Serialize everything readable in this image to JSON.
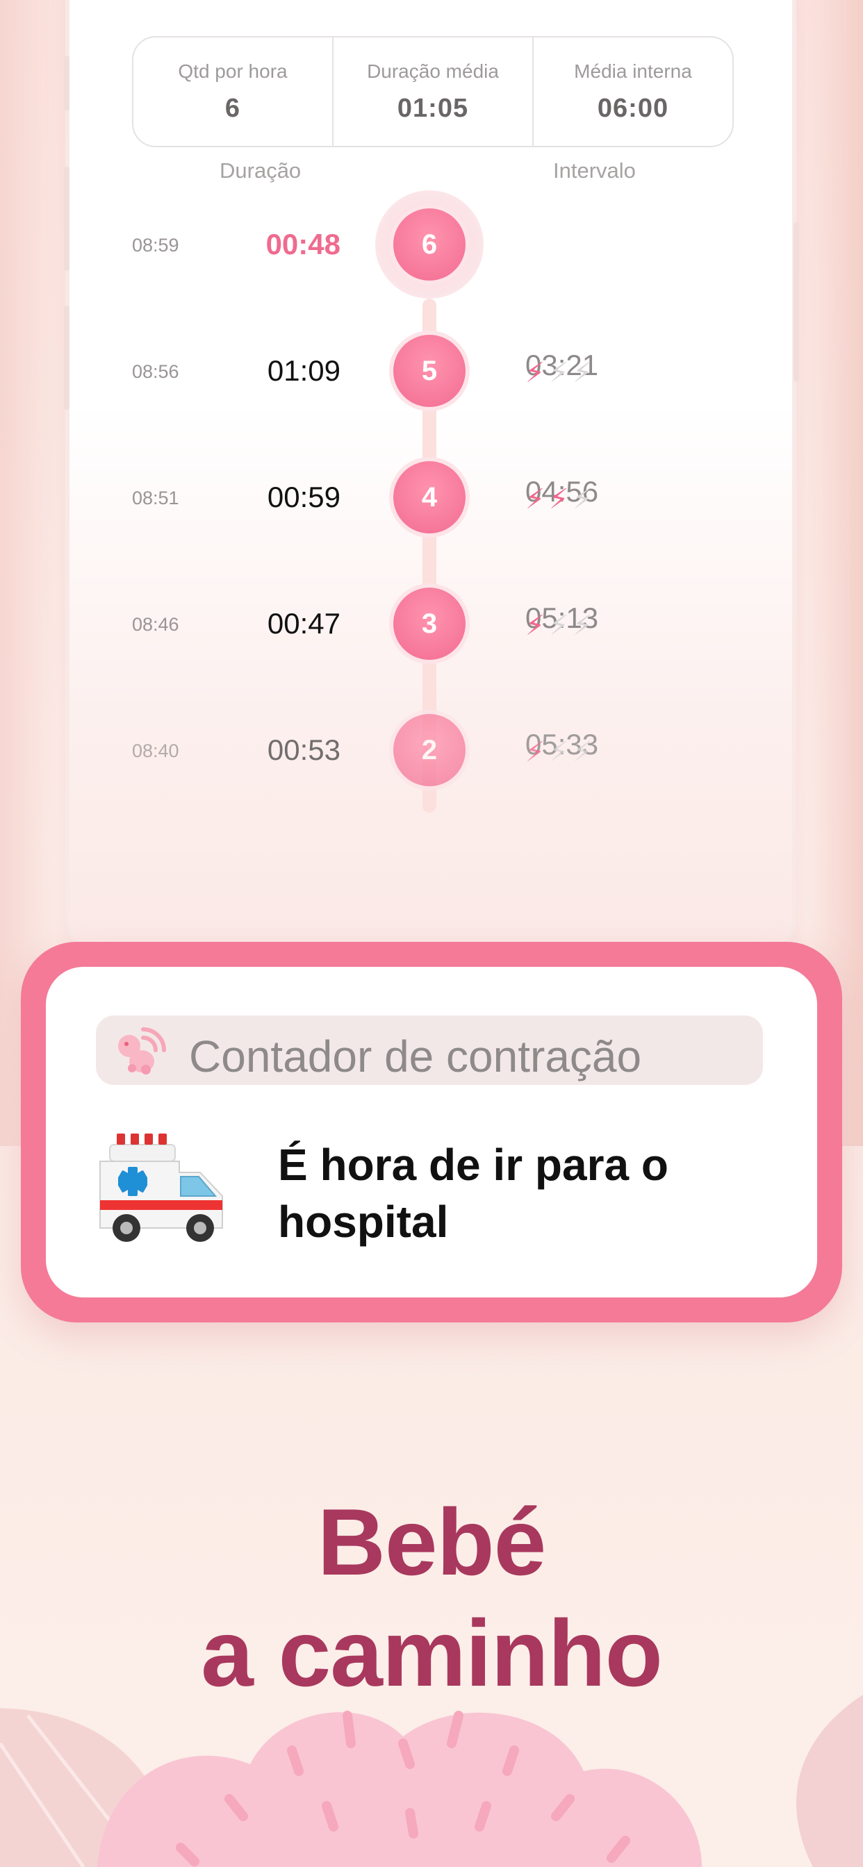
{
  "stats": [
    {
      "label": "Qtd por hora",
      "value": "6"
    },
    {
      "label": "Duração média",
      "value": "01:05"
    },
    {
      "label": "Média interna",
      "value": "06:00"
    }
  ],
  "columns": {
    "duration": "Duração",
    "interval": "Intervalo"
  },
  "contractions": [
    {
      "number": "6",
      "time": "08:59",
      "duration": "00:48",
      "active": true,
      "intensity": 0
    },
    {
      "number": "5",
      "time": "08:56",
      "duration": "01:09",
      "active": false,
      "intensity": 1
    },
    {
      "number": "4",
      "time": "08:51",
      "duration": "00:59",
      "active": false,
      "intensity": 2
    },
    {
      "number": "3",
      "time": "08:46",
      "duration": "00:47",
      "active": false,
      "intensity": 1
    },
    {
      "number": "2",
      "time": "08:40",
      "duration": "00:53",
      "active": false,
      "intensity": 1
    }
  ],
  "intervals": [
    "03:21",
    "04:56",
    "05:13",
    "05:33"
  ],
  "notification": {
    "app_name": "Contador de contração",
    "message": "É hora de ir para o hospital",
    "icon": "ambulance-emoji"
  },
  "headline": {
    "line1": "Bebé",
    "line2": "a caminho"
  },
  "colors": {
    "accent": "#f47a97",
    "headline": "#a8385e",
    "active_duration": "#ef6b8f"
  }
}
